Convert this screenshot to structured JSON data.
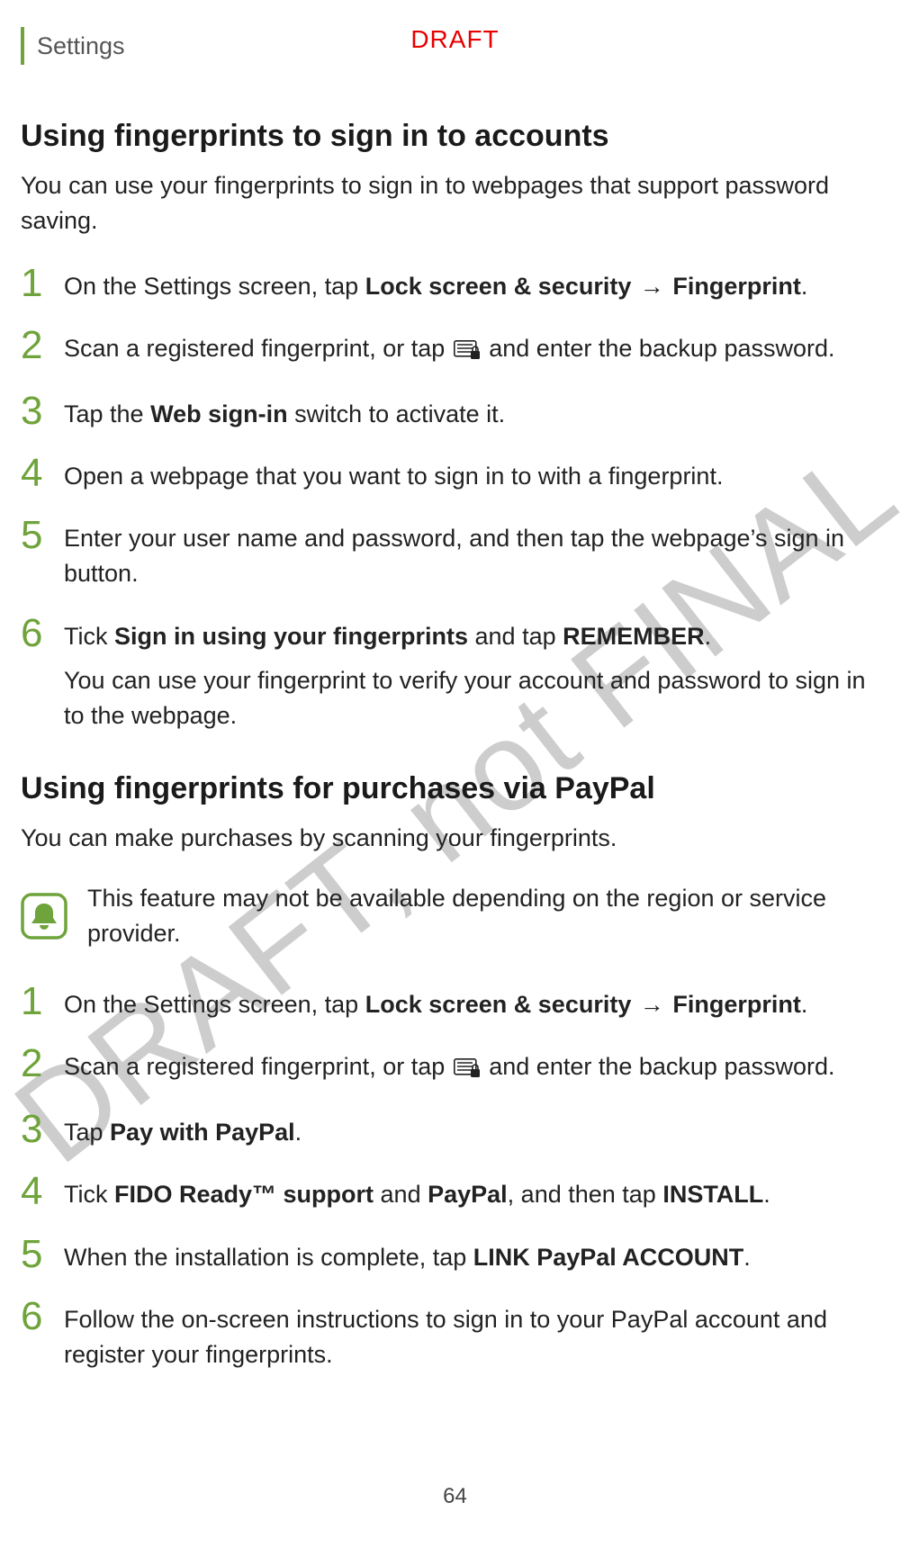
{
  "header": {
    "section_label": "Settings",
    "draft_label": "DRAFT"
  },
  "watermark": "DRAFT, not FINAL",
  "page_number": "64",
  "section1": {
    "title": "Using fingerprints to sign in to accounts",
    "intro": "You can use your fingerprints to sign in to webpages that support password saving.",
    "steps": [
      {
        "num": "1",
        "pre": "On the Settings screen, tap ",
        "b1": "Lock screen & security",
        "arrow": " → ",
        "b2": "Fingerprint",
        "post": "."
      },
      {
        "num": "2",
        "pre": "Scan a registered fingerprint, or tap ",
        "post": " and enter the backup password."
      },
      {
        "num": "3",
        "pre": "Tap the ",
        "b1": "Web sign-in",
        "post": " switch to activate it."
      },
      {
        "num": "4",
        "text": "Open a webpage that you want to sign in to with a fingerprint."
      },
      {
        "num": "5",
        "text": "Enter your user name and password, and then tap the webpage’s sign in button."
      },
      {
        "num": "6",
        "pre": "Tick ",
        "b1": "Sign in using your fingerprints",
        "mid": " and tap ",
        "b2": "REMEMBER",
        "post": ".",
        "sub": "You can use your fingerprint to verify your account and password to sign in to the webpage."
      }
    ]
  },
  "section2": {
    "title": "Using fingerprints for purchases via PayPal",
    "intro": "You can make purchases by scanning your fingerprints.",
    "note": "This feature may not be available depending on the region or service provider.",
    "steps": [
      {
        "num": "1",
        "pre": "On the Settings screen, tap ",
        "b1": "Lock screen & security",
        "arrow": " → ",
        "b2": "Fingerprint",
        "post": "."
      },
      {
        "num": "2",
        "pre": "Scan a registered fingerprint, or tap ",
        "post": " and enter the backup password."
      },
      {
        "num": "3",
        "pre": "Tap ",
        "b1": "Pay with PayPal",
        "post": "."
      },
      {
        "num": "4",
        "pre": "Tick ",
        "b1": "FIDO Ready™ support",
        "mid": " and ",
        "b2": "PayPal",
        "mid2": ", and then tap ",
        "b3": "INSTALL",
        "post": "."
      },
      {
        "num": "5",
        "pre": "When the installation is complete, tap ",
        "b1": "LINK PayPal ACCOUNT",
        "post": "."
      },
      {
        "num": "6",
        "text": "Follow the on-screen instructions to sign in to your PayPal account and register your fingerprints."
      }
    ]
  }
}
